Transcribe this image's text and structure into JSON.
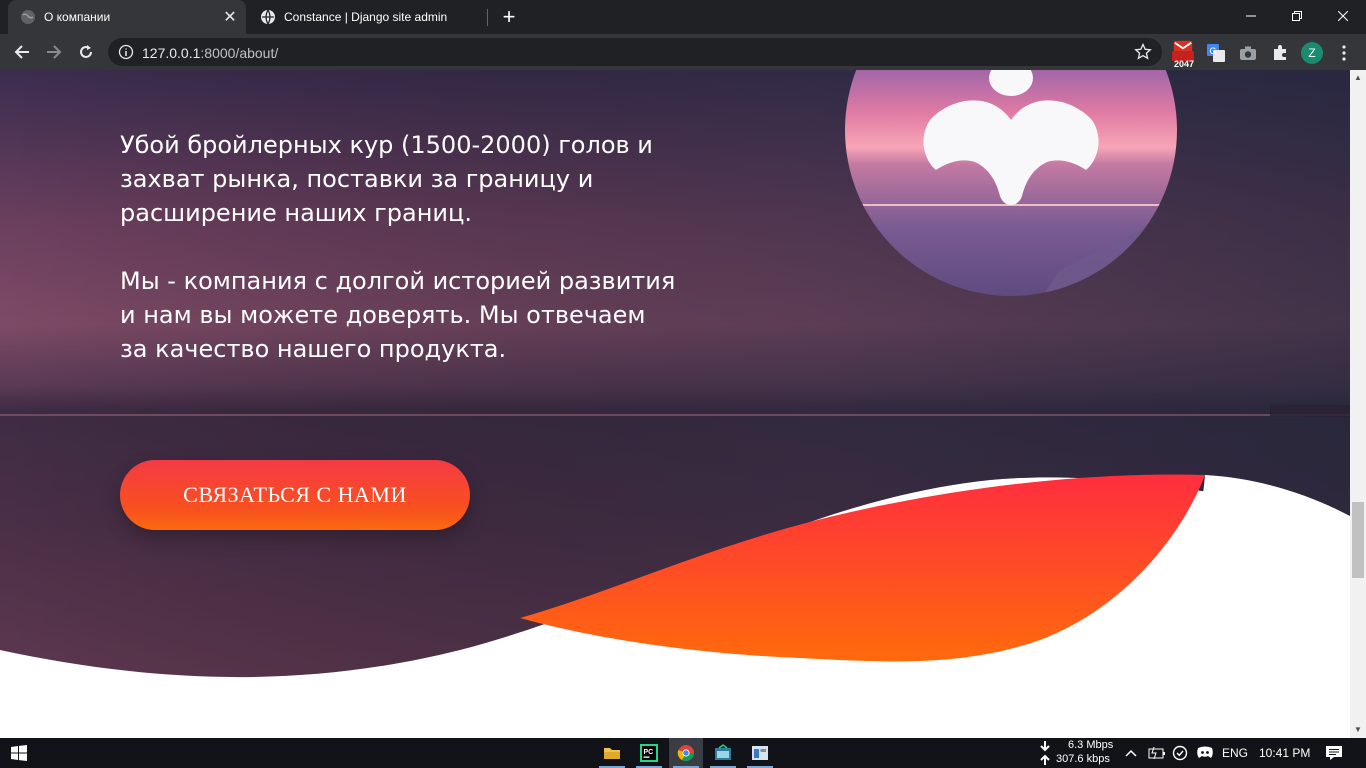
{
  "browser": {
    "tabs": [
      {
        "title": "О компании",
        "active": true
      },
      {
        "title": "Constance | Django site admin",
        "active": false
      }
    ],
    "url_host": "127.0.0.1",
    "url_rest": ":8000/about/",
    "gmail_badge": "2047",
    "profile_initial": "Z"
  },
  "page": {
    "paragraph1": "Убой бройлерных кур (1500-2000) голов и захват рынка, поставки за границу и расширение наших границ.",
    "paragraph2": "Мы - компания с долгой историей развития и нам вы можете доверять. Мы отвечаем за качество нашего продукта.",
    "cta_label": "СВЯЗАТЬСЯ С НАМИ",
    "accent_color": "#f8501f"
  },
  "taskbar": {
    "download_speed": "6.3 Mbps",
    "upload_speed": "307.6 kbps",
    "language": "ENG",
    "time": "10:41 PM"
  }
}
